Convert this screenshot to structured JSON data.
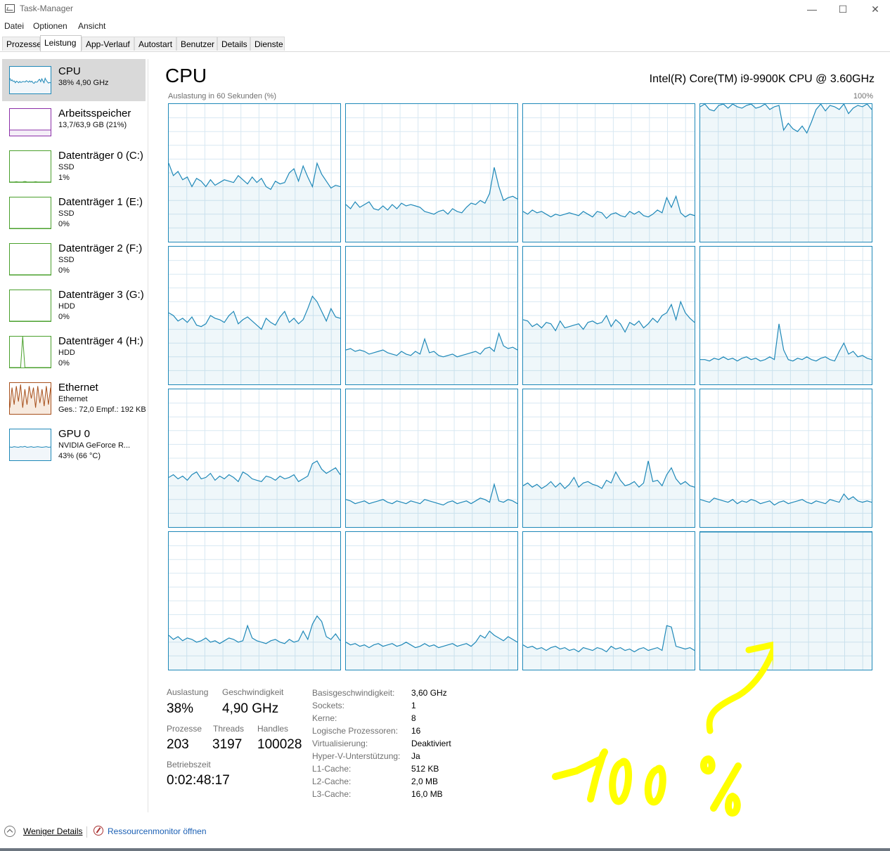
{
  "window": {
    "title": "Task-Manager",
    "minimize_glyph": "—",
    "maximize_glyph": "☐",
    "close_glyph": "✕"
  },
  "menu": [
    "Datei",
    "Optionen",
    "Ansicht"
  ],
  "tabs": [
    {
      "label": "Prozesse",
      "active": false
    },
    {
      "label": "Leistung",
      "active": true
    },
    {
      "label": "App-Verlauf",
      "active": false
    },
    {
      "label": "Autostart",
      "active": false
    },
    {
      "label": "Benutzer",
      "active": false
    },
    {
      "label": "Details",
      "active": false
    },
    {
      "label": "Dienste",
      "active": false
    }
  ],
  "sidebar": {
    "items": [
      {
        "name": "CPU",
        "lines": [
          "38% 4,90 GHz"
        ],
        "color": "#1e88b8",
        "selected": true
      },
      {
        "name": "Arbeitsspeicher",
        "lines": [
          "13,7/63,9 GB (21%)"
        ],
        "color": "#8b2fa8",
        "selected": false
      },
      {
        "name": "Datenträger 0 (C:)",
        "lines": [
          "SSD",
          "1%"
        ],
        "color": "#4aa02c",
        "selected": false
      },
      {
        "name": "Datenträger 1 (E:)",
        "lines": [
          "SSD",
          "0%"
        ],
        "color": "#4aa02c",
        "selected": false
      },
      {
        "name": "Datenträger 2 (F:)",
        "lines": [
          "SSD",
          "0%"
        ],
        "color": "#4aa02c",
        "selected": false
      },
      {
        "name": "Datenträger 3 (G:)",
        "lines": [
          "HDD",
          "0%"
        ],
        "color": "#4aa02c",
        "selected": false
      },
      {
        "name": "Datenträger 4 (H:)",
        "lines": [
          "HDD",
          "0%"
        ],
        "color": "#4aa02c",
        "selected": false
      },
      {
        "name": "Ethernet",
        "lines": [
          "Ethernet",
          "Ges.: 72,0  Empf.: 192 KB"
        ],
        "color": "#a7501c",
        "selected": false
      },
      {
        "name": "GPU 0",
        "lines": [
          "NVIDIA GeForce R...",
          "43%  (66 °C)"
        ],
        "color": "#1e88b8",
        "selected": false
      }
    ]
  },
  "main": {
    "title": "CPU",
    "model": "Intel(R) Core(TM) i9-9900K CPU @ 3.60GHz",
    "axis_label": "Auslastung in 60 Sekunden (%)",
    "axis_max": "100%"
  },
  "chart_data": {
    "type": "area",
    "title": "Auslastung in 60 Sekunden (%)",
    "ylim": [
      0,
      100
    ],
    "grid": true,
    "series": [
      {
        "values": [
          57,
          48,
          51,
          45,
          47,
          40,
          46,
          44,
          40,
          45,
          41,
          43,
          45,
          44,
          43,
          48,
          45,
          42,
          47,
          43,
          46,
          40,
          38,
          44,
          42,
          43,
          50,
          53,
          44,
          55,
          47,
          40,
          57,
          49,
          44,
          39,
          41,
          40
        ]
      },
      {
        "values": [
          27,
          24,
          29,
          25,
          27,
          29,
          24,
          23,
          26,
          23,
          27,
          24,
          28,
          26,
          27,
          26,
          25,
          22,
          21,
          20,
          22,
          23,
          20,
          24,
          22,
          21,
          25,
          28,
          27,
          30,
          28,
          35,
          54,
          40,
          30,
          32,
          33,
          31
        ]
      },
      {
        "values": [
          22,
          20,
          23,
          21,
          22,
          20,
          18,
          20,
          19,
          20,
          21,
          20,
          19,
          22,
          20,
          18,
          22,
          21,
          17,
          20,
          21,
          19,
          18,
          22,
          20,
          22,
          19,
          18,
          20,
          23,
          21,
          32,
          25,
          33,
          21,
          18,
          20,
          19
        ]
      },
      {
        "values": [
          98,
          100,
          96,
          95,
          99,
          100,
          97,
          100,
          98,
          97,
          99,
          100,
          97,
          98,
          100,
          96,
          98,
          99,
          81,
          86,
          82,
          80,
          84,
          79,
          87,
          96,
          100,
          95,
          99,
          98,
          96,
          100,
          93,
          97,
          99,
          98,
          100,
          96
        ]
      },
      {
        "values": [
          52,
          50,
          46,
          48,
          45,
          49,
          43,
          42,
          44,
          50,
          48,
          47,
          45,
          50,
          53,
          44,
          47,
          49,
          46,
          43,
          40,
          48,
          45,
          43,
          49,
          53,
          45,
          48,
          44,
          47,
          55,
          64,
          60,
          53,
          46,
          55,
          49,
          48
        ]
      },
      {
        "values": [
          25,
          26,
          24,
          25,
          24,
          22,
          23,
          24,
          25,
          23,
          22,
          21,
          24,
          22,
          21,
          24,
          22,
          33,
          23,
          24,
          21,
          20,
          21,
          22,
          20,
          21,
          22,
          23,
          24,
          22,
          26,
          27,
          24,
          37,
          28,
          26,
          27,
          25
        ]
      },
      {
        "values": [
          47,
          46,
          42,
          44,
          41,
          45,
          44,
          39,
          46,
          41,
          42,
          43,
          44,
          40,
          45,
          46,
          44,
          45,
          50,
          42,
          47,
          44,
          38,
          45,
          43,
          46,
          41,
          44,
          48,
          45,
          50,
          52,
          58,
          47,
          60,
          52,
          48,
          45
        ]
      },
      {
        "values": [
          18,
          18,
          17,
          19,
          18,
          20,
          18,
          19,
          17,
          19,
          20,
          18,
          19,
          17,
          18,
          20,
          18,
          44,
          25,
          18,
          17,
          19,
          18,
          20,
          18,
          17,
          19,
          20,
          18,
          17,
          24,
          30,
          22,
          24,
          20,
          21,
          19,
          18
        ]
      },
      {
        "values": [
          36,
          38,
          35,
          37,
          34,
          38,
          40,
          35,
          36,
          39,
          34,
          37,
          35,
          38,
          36,
          33,
          40,
          38,
          35,
          34,
          33,
          37,
          36,
          34,
          37,
          35,
          36,
          38,
          33,
          35,
          37,
          46,
          48,
          42,
          39,
          41,
          43,
          38
        ]
      },
      {
        "values": [
          20,
          19,
          17,
          18,
          19,
          17,
          18,
          19,
          20,
          18,
          17,
          19,
          18,
          17,
          19,
          18,
          17,
          20,
          19,
          18,
          17,
          16,
          18,
          19,
          17,
          18,
          19,
          17,
          19,
          21,
          20,
          18,
          31,
          19,
          18,
          20,
          19,
          17
        ]
      },
      {
        "values": [
          30,
          32,
          29,
          31,
          28,
          30,
          33,
          29,
          32,
          28,
          31,
          36,
          29,
          32,
          33,
          31,
          30,
          28,
          34,
          32,
          40,
          34,
          30,
          31,
          33,
          29,
          32,
          48,
          33,
          34,
          30,
          38,
          43,
          35,
          31,
          33,
          30,
          29
        ]
      },
      {
        "values": [
          20,
          19,
          18,
          21,
          20,
          19,
          18,
          20,
          17,
          19,
          18,
          20,
          19,
          17,
          18,
          19,
          16,
          18,
          19,
          17,
          18,
          19,
          20,
          18,
          17,
          19,
          18,
          17,
          20,
          19,
          18,
          24,
          20,
          22,
          19,
          18,
          19,
          18
        ]
      },
      {
        "values": [
          25,
          22,
          24,
          21,
          23,
          22,
          20,
          21,
          23,
          20,
          21,
          19,
          21,
          23,
          22,
          20,
          21,
          32,
          23,
          21,
          20,
          19,
          21,
          22,
          20,
          19,
          22,
          20,
          21,
          28,
          22,
          33,
          39,
          35,
          24,
          22,
          26,
          21
        ]
      },
      {
        "values": [
          20,
          18,
          19,
          17,
          18,
          16,
          18,
          19,
          17,
          18,
          19,
          17,
          18,
          20,
          18,
          16,
          17,
          19,
          17,
          18,
          16,
          17,
          18,
          19,
          17,
          18,
          19,
          17,
          20,
          25,
          23,
          28,
          25,
          23,
          21,
          24,
          22,
          20
        ]
      },
      {
        "values": [
          18,
          16,
          17,
          15,
          16,
          14,
          16,
          17,
          15,
          16,
          14,
          15,
          13,
          16,
          15,
          14,
          16,
          15,
          13,
          17,
          15,
          16,
          14,
          15,
          13,
          15,
          16,
          14,
          15,
          16,
          14,
          32,
          31,
          17,
          16,
          15,
          16,
          14
        ]
      },
      {
        "values": [
          100,
          100,
          100,
          100,
          100,
          100,
          100,
          100,
          100,
          100,
          100,
          100,
          100,
          100,
          100,
          100,
          100,
          100,
          100,
          100,
          100,
          100,
          100,
          100,
          100,
          100,
          100,
          100,
          100,
          100,
          100,
          100,
          100,
          100,
          100,
          100,
          100,
          100
        ]
      }
    ]
  },
  "stats": {
    "auslastung_label": "Auslastung",
    "auslastung_value": "38%",
    "geschwindigkeit_label": "Geschwindigkeit",
    "geschwindigkeit_value": "4,90 GHz",
    "prozesse_label": "Prozesse",
    "prozesse_value": "203",
    "threads_label": "Threads",
    "threads_value": "3197",
    "handles_label": "Handles",
    "handles_value": "100028",
    "betriebszeit_label": "Betriebszeit",
    "betriebszeit_value": "0:02:48:17"
  },
  "details": [
    {
      "label": "Basisgeschwindigkeit:",
      "value": "3,60 GHz"
    },
    {
      "label": "Sockets:",
      "value": "1"
    },
    {
      "label": "Kerne:",
      "value": "8"
    },
    {
      "label": "Logische Prozessoren:",
      "value": "16"
    },
    {
      "label": "Virtualisierung:",
      "value": "Deaktiviert"
    },
    {
      "label": "Hyper-V-Unterstützung:",
      "value": "Ja"
    },
    {
      "label": "L1-Cache:",
      "value": "512 KB"
    },
    {
      "label": "L2-Cache:",
      "value": "2,0 MB"
    },
    {
      "label": "L3-Cache:",
      "value": "16,0 MB"
    }
  ],
  "footer": {
    "less_details": "Weniger Details",
    "resource_monitor": "Ressourcenmonitor öffnen"
  },
  "annotation": {
    "text": "100 %",
    "color": "#ffff00"
  }
}
